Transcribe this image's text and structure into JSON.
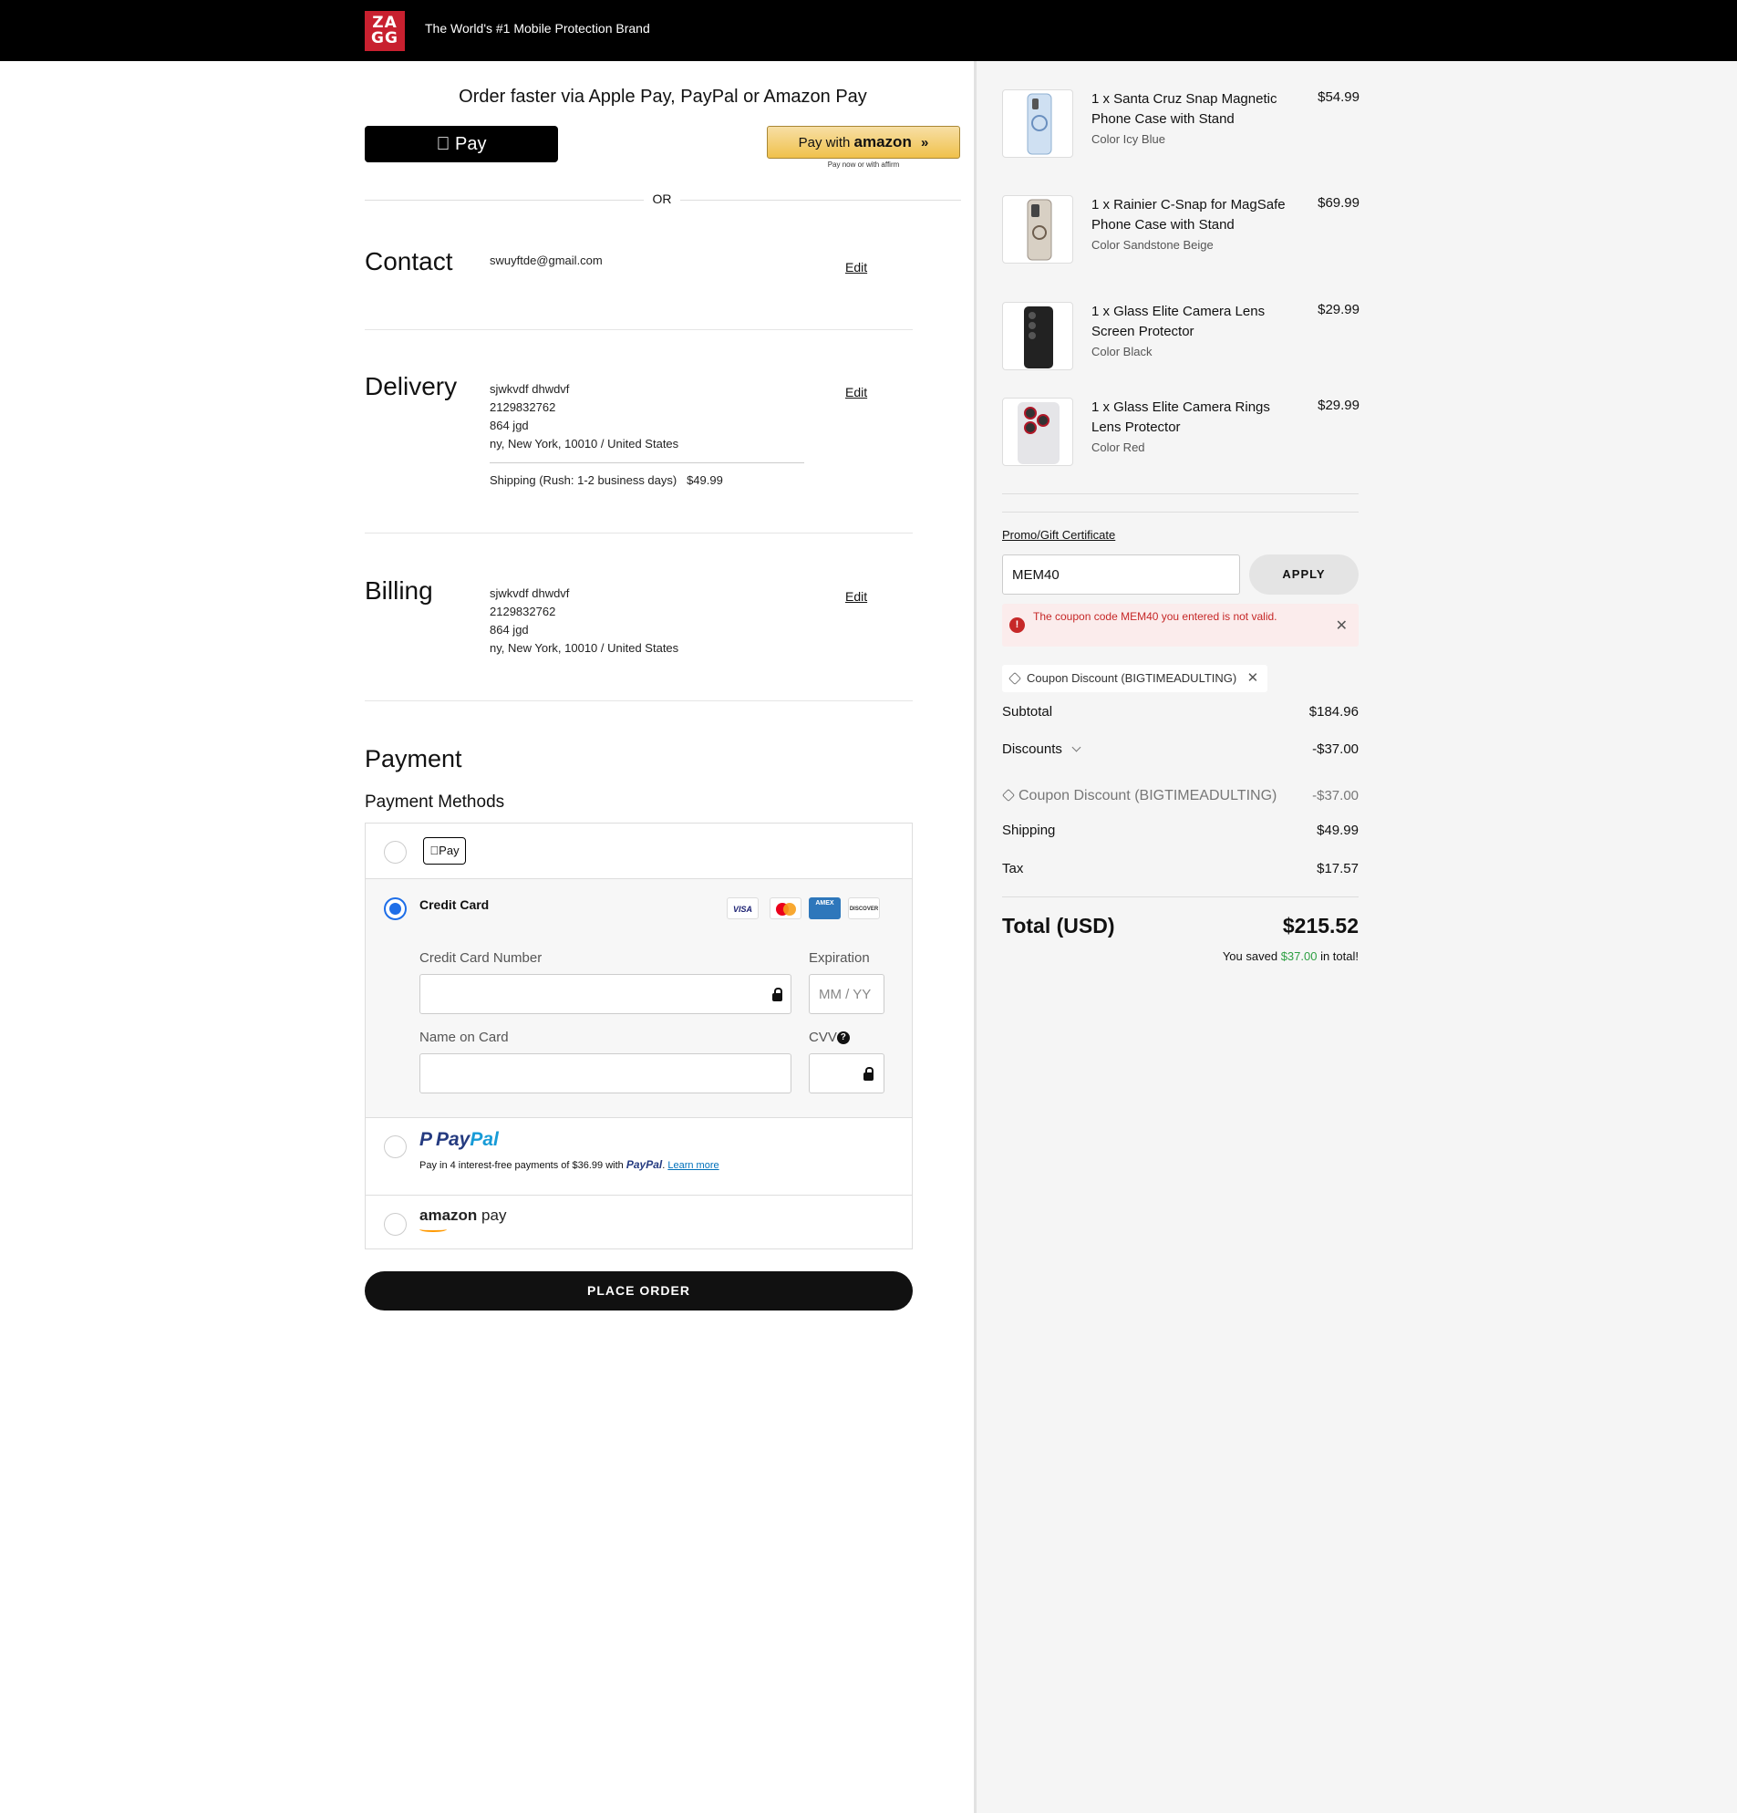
{
  "header": {
    "logo_text": "ZA GG",
    "tagline": "The World's #1 Mobile Protection Brand",
    "bg_color": "#000000",
    "logo_color": "#c8202f"
  },
  "express": {
    "title": "Order faster via Apple Pay, PayPal or Amazon Pay",
    "apple_pay_label": "Pay",
    "amazon_pay_prefix": "Pay with",
    "amazon_pay_brand": "amazon",
    "affirm_note": "Pay now or with affirm",
    "or_label": "OR"
  },
  "contact": {
    "title": "Contact",
    "email": "swuyftde@gmail.com",
    "edit_label": "Edit"
  },
  "delivery": {
    "title": "Delivery",
    "name": "sjwkvdf dhwdvf",
    "phone": "2129832762",
    "address1": "864 jgd",
    "address2": "ny, New York, 10010 / United States",
    "shipping_method": "Shipping (Rush: 1-2 business days)",
    "shipping_price": "$49.99",
    "edit_label": "Edit"
  },
  "billing": {
    "title": "Billing",
    "name": "sjwkvdf dhwdvf",
    "phone": "2129832762",
    "address1": "864 jgd",
    "address2": "ny, New York, 10010 / United States",
    "edit_label": "Edit"
  },
  "payment": {
    "title": "Payment",
    "methods_title": "Payment Methods",
    "apple_pay_mark": "Pay",
    "credit_card_label": "Credit Card",
    "selected_method": "Credit Card",
    "card_brands": [
      "VISA",
      "mastercard",
      "AMEX",
      "DISCOVER"
    ],
    "card_number_label": "Credit Card Number",
    "card_number_value": "",
    "expiration_label": "Expiration",
    "expiration_placeholder": "MM / YY",
    "name_label": "Name on Card",
    "name_value": "",
    "cvv_label": "CVV",
    "cvv_value": "",
    "paypal_logo_pay": "Pay",
    "paypal_logo_pal": "Pal",
    "paypal_message": "Pay in 4 interest-free payments of $36.99 with",
    "paypal_inline_brand": "PayPal",
    "paypal_learn_more": "Learn more",
    "amazon_pay_logo_amazon": "amazon",
    "amazon_pay_logo_pay": "pay",
    "place_order_label": "PLACE ORDER",
    "accent_color": "#1e6ee8"
  },
  "cart": {
    "items": [
      {
        "name": "1 x Santa Cruz Snap Magnetic Phone Case with Stand",
        "option": "Color Icy Blue",
        "price": "$54.99"
      },
      {
        "name": "1 x Rainier C-Snap for MagSafe Phone Case with Stand",
        "option": "Color Sandstone Beige",
        "price": "$69.99"
      },
      {
        "name": "1 x Glass Elite Camera Lens Screen Protector",
        "option": "Color Black",
        "price": "$29.99"
      },
      {
        "name": "1 x Glass Elite Camera Rings Lens Protector",
        "option": "Color Red",
        "price": "$29.99"
      }
    ]
  },
  "promo": {
    "label": "Promo/Gift Certificate",
    "input_value": "MEM40",
    "apply_label": "APPLY",
    "error_message": "The coupon code MEM40 you entered is not valid.",
    "applied_coupon": "Coupon Discount (BIGTIMEADULTING)",
    "error_color": "#c62828"
  },
  "summary": {
    "subtotal_label": "Subtotal",
    "subtotal_value": "$184.96",
    "discounts_label": "Discounts",
    "discounts_value": "-$37.00",
    "coupon_line_label": "Coupon Discount (BIGTIMEADULTING)",
    "coupon_line_value": "-$37.00",
    "shipping_label": "Shipping",
    "shipping_value": "$49.99",
    "tax_label": "Tax",
    "tax_value": "$17.57",
    "total_label": "Total (USD)",
    "total_value": "$215.52",
    "saved_prefix": "You saved",
    "saved_amount": "$37.00",
    "saved_suffix": "in total!",
    "saved_color": "#2ea043"
  }
}
